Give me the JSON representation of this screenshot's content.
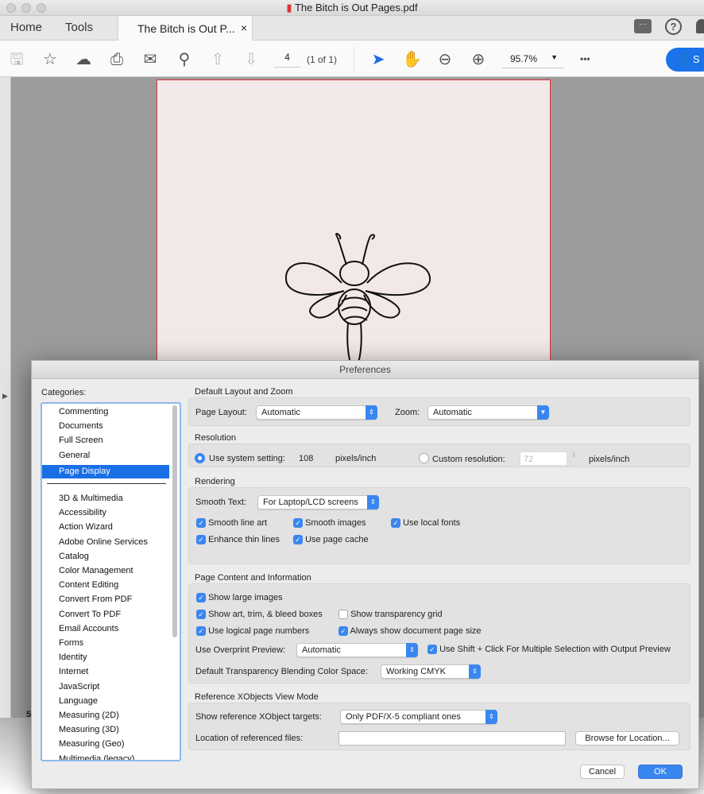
{
  "window": {
    "title": "The Bitch is Out Pages.pdf"
  },
  "tabs": {
    "home": "Home",
    "tools": "Tools",
    "document": "The Bitch is Out P...",
    "close": "×"
  },
  "toolbar": {
    "page_number": "4",
    "page_count": "(1 of 1)",
    "zoom": "95.7%",
    "more": "•••",
    "share_label": "S"
  },
  "page_bottom_label": "5",
  "dialog": {
    "title": "Preferences",
    "categories_label": "Categories:",
    "categories_top": [
      "Commenting",
      "Documents",
      "Full Screen",
      "General",
      "Page Display"
    ],
    "categories": [
      "3D & Multimedia",
      "Accessibility",
      "Action Wizard",
      "Adobe Online Services",
      "Catalog",
      "Color Management",
      "Content Editing",
      "Convert From PDF",
      "Convert To PDF",
      "Email Accounts",
      "Forms",
      "Identity",
      "Internet",
      "JavaScript",
      "Language",
      "Measuring (2D)",
      "Measuring (3D)",
      "Measuring (Geo)",
      "Multimedia (legacy)"
    ],
    "selected_category": "Page Display",
    "layout": {
      "heading": "Default Layout and Zoom",
      "page_layout_label": "Page Layout:",
      "page_layout_value": "Automatic",
      "zoom_label": "Zoom:",
      "zoom_value": "Automatic"
    },
    "resolution": {
      "heading": "Resolution",
      "system_label": "Use system setting:",
      "system_value": "108",
      "unit": "pixels/inch",
      "custom_label": "Custom resolution:",
      "custom_value": "72",
      "unit2": "pixels/inch",
      "selected": "system"
    },
    "rendering": {
      "heading": "Rendering",
      "smooth_text_label": "Smooth Text:",
      "smooth_text_value": "For Laptop/LCD screens",
      "checks": [
        {
          "label": "Smooth line art",
          "checked": true
        },
        {
          "label": "Smooth images",
          "checked": true
        },
        {
          "label": "Use local fonts",
          "checked": true
        },
        {
          "label": "Enhance thin lines",
          "checked": true
        },
        {
          "label": "Use page cache",
          "checked": true
        }
      ]
    },
    "content": {
      "heading": "Page Content and Information",
      "checks": [
        {
          "label": "Show large images",
          "checked": true
        },
        {
          "label": "Show art, trim, & bleed boxes",
          "checked": true
        },
        {
          "label": "Show transparency grid",
          "checked": false
        },
        {
          "label": "Use logical page numbers",
          "checked": true
        },
        {
          "label": "Always show document page size",
          "checked": true
        },
        {
          "label": "Use Shift + Click For Multiple Selection with Output Preview",
          "checked": true
        }
      ],
      "overprint_label": "Use Overprint Preview:",
      "overprint_value": "Automatic",
      "blend_label": "Default Transparency Blending Color Space:",
      "blend_value": "Working CMYK"
    },
    "xobjects": {
      "heading": "Reference XObjects View Mode",
      "targets_label": "Show reference XObject targets:",
      "targets_value": "Only PDF/X-5 compliant ones",
      "location_label": "Location of referenced files:",
      "location_value": "",
      "browse": "Browse for Location..."
    },
    "cancel": "Cancel",
    "ok": "OK"
  },
  "colors": {
    "accent": "#3a86f0",
    "selection": "#1a6ee6",
    "page_border": "#dd3333"
  }
}
